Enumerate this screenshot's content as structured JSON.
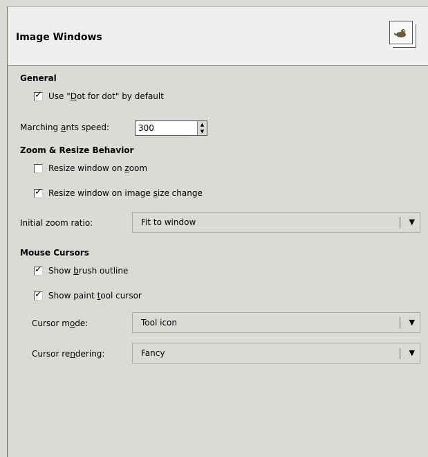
{
  "header": {
    "title": "Image Windows",
    "icon": "gimp-wilber-icon"
  },
  "general": {
    "heading": "General",
    "dot_for_dot": {
      "pre": "Use \"",
      "key": "D",
      "post": "ot for dot\" by default",
      "checked": true
    },
    "marching_ants": {
      "pre": "Marching ",
      "key": "a",
      "post": "nts speed:",
      "value": "300"
    }
  },
  "zoom": {
    "heading": "Zoom & Resize Behavior",
    "resize_on_zoom": {
      "pre": "Resize window on ",
      "key": "z",
      "post": "oom",
      "checked": false
    },
    "resize_on_change": {
      "pre": "Resize window on image ",
      "key": "s",
      "post": "ize change",
      "checked": true
    },
    "initial_zoom": {
      "label": "Initial zoom ratio:",
      "value": "Fit to window"
    }
  },
  "cursors": {
    "heading": "Mouse Cursors",
    "brush_outline": {
      "pre": "Show ",
      "key": "b",
      "post": "rush outline",
      "checked": true
    },
    "paint_tool": {
      "pre": "Show paint ",
      "key": "t",
      "post": "ool cursor",
      "checked": true
    },
    "cursor_mode": {
      "pre": "Cursor m",
      "key": "o",
      "post": "de:",
      "value": "Tool icon"
    },
    "cursor_rendering": {
      "pre": "Cursor re",
      "key": "n",
      "post": "dering:",
      "value": "Fancy"
    }
  }
}
